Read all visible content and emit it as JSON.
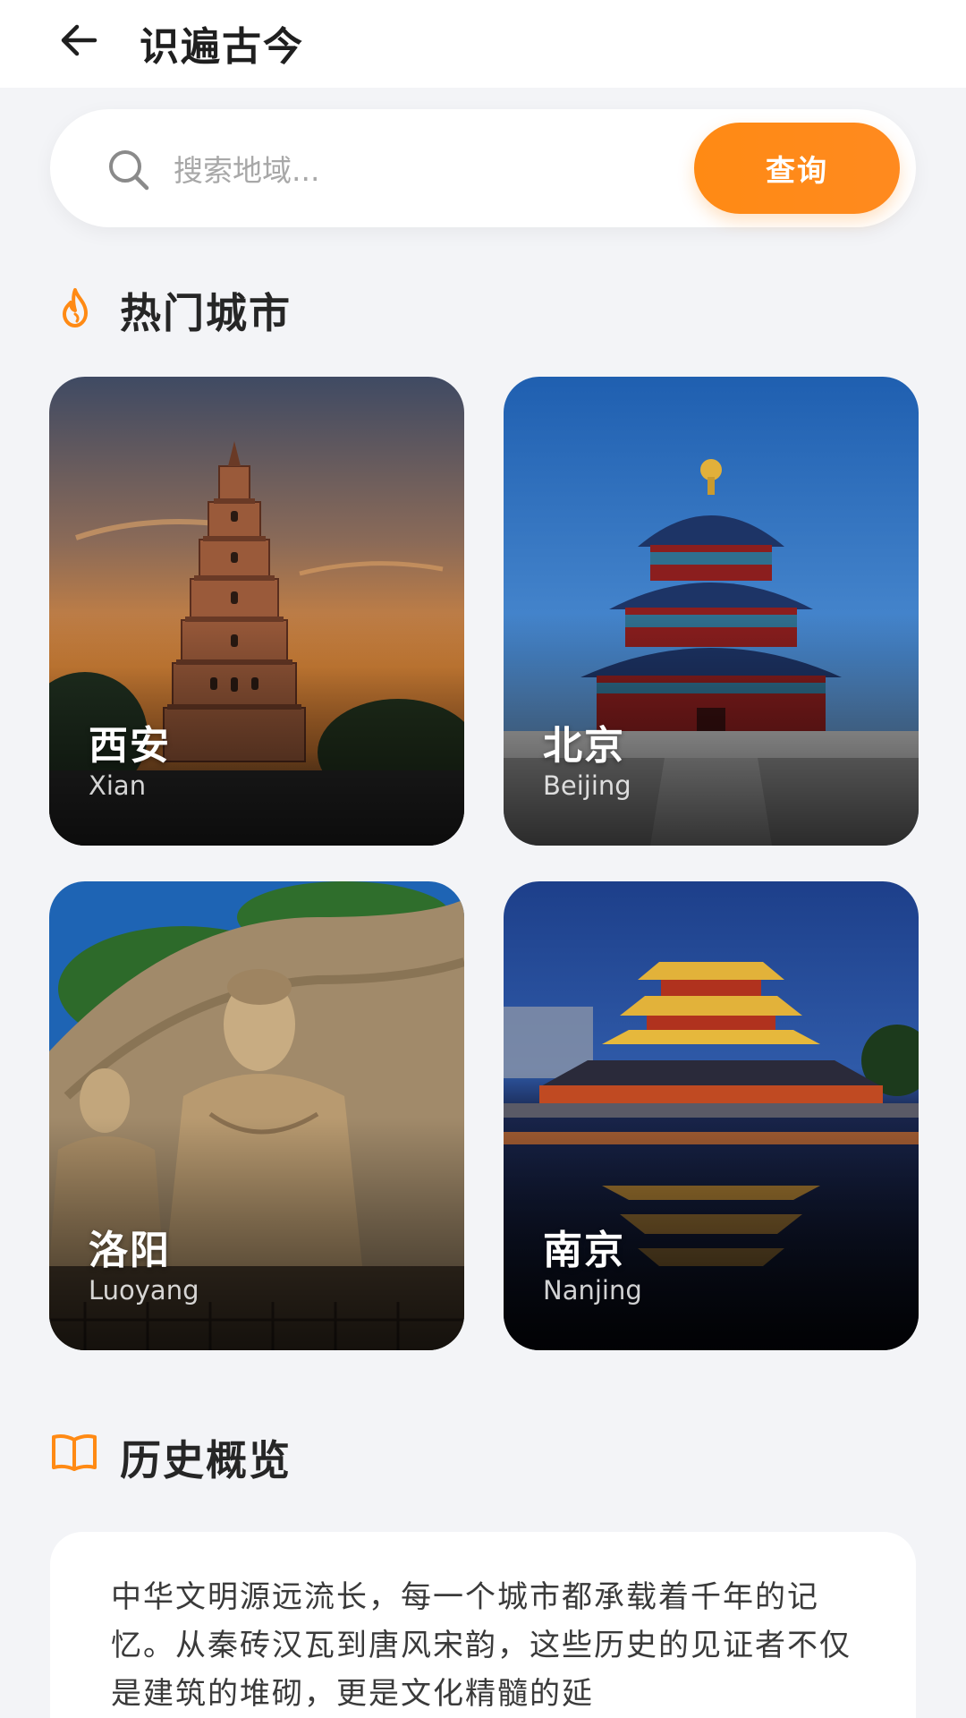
{
  "header": {
    "title": "识遍古今",
    "back_icon": "arrow-left-icon"
  },
  "search": {
    "placeholder": "搜索地域...",
    "value": "",
    "button_label": "查询",
    "icon": "search-icon"
  },
  "hot_cities": {
    "title": "热门城市",
    "icon": "flame-icon",
    "accent": "#ff8a14",
    "cities": [
      {
        "name_cn": "西安",
        "name_en": "Xian"
      },
      {
        "name_cn": "北京",
        "name_en": "Beijing"
      },
      {
        "name_cn": "洛阳",
        "name_en": "Luoyang"
      },
      {
        "name_cn": "南京",
        "name_en": "Nanjing"
      }
    ]
  },
  "history": {
    "title": "历史概览",
    "icon": "open-book-icon",
    "text": "中华文明源远流长，每一个城市都承载着千年的记忆。从秦砖汉瓦到唐风宋韵，这些历史的见证者不仅是建筑的堆砌，更是文化精髓的延"
  }
}
